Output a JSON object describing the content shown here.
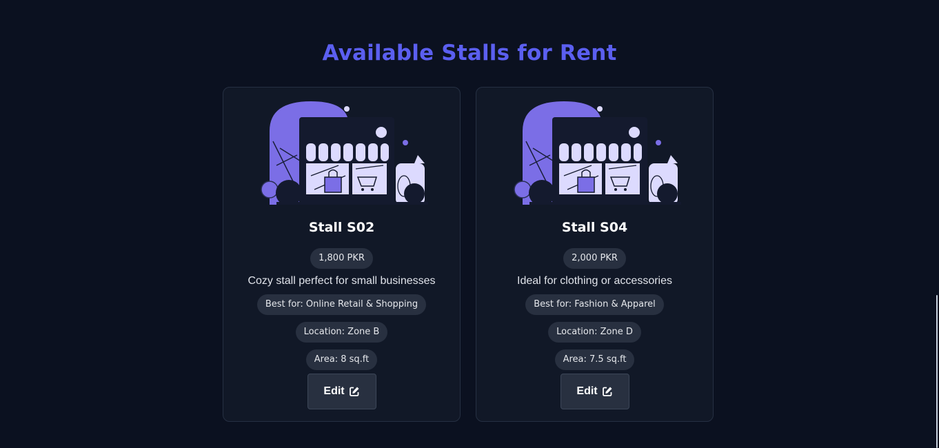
{
  "page": {
    "title": "Available Stalls for Rent"
  },
  "colors": {
    "background": "#0b1120",
    "card": "#111827",
    "accent": "#5b5ff0",
    "illustration_purple": "#7b6ee6",
    "illustration_light": "#dcdafe",
    "pill": "#283040"
  },
  "stalls": [
    {
      "name": "Stall S02",
      "price": "1,800 PKR",
      "description": "Cozy stall perfect for small businesses",
      "best_for": "Best for: Online Retail & Shopping",
      "location": "Location: Zone B",
      "area": "Area: 8 sq.ft",
      "edit_label": "Edit",
      "edit_icon": "edit-icon",
      "image": "storefront-illustration"
    },
    {
      "name": "Stall S04",
      "price": "2,000 PKR",
      "description": "Ideal for clothing or accessories",
      "best_for": "Best for: Fashion & Apparel",
      "location": "Location: Zone D",
      "area": "Area: 7.5 sq.ft",
      "edit_label": "Edit",
      "edit_icon": "edit-icon",
      "image": "storefront-illustration"
    }
  ]
}
